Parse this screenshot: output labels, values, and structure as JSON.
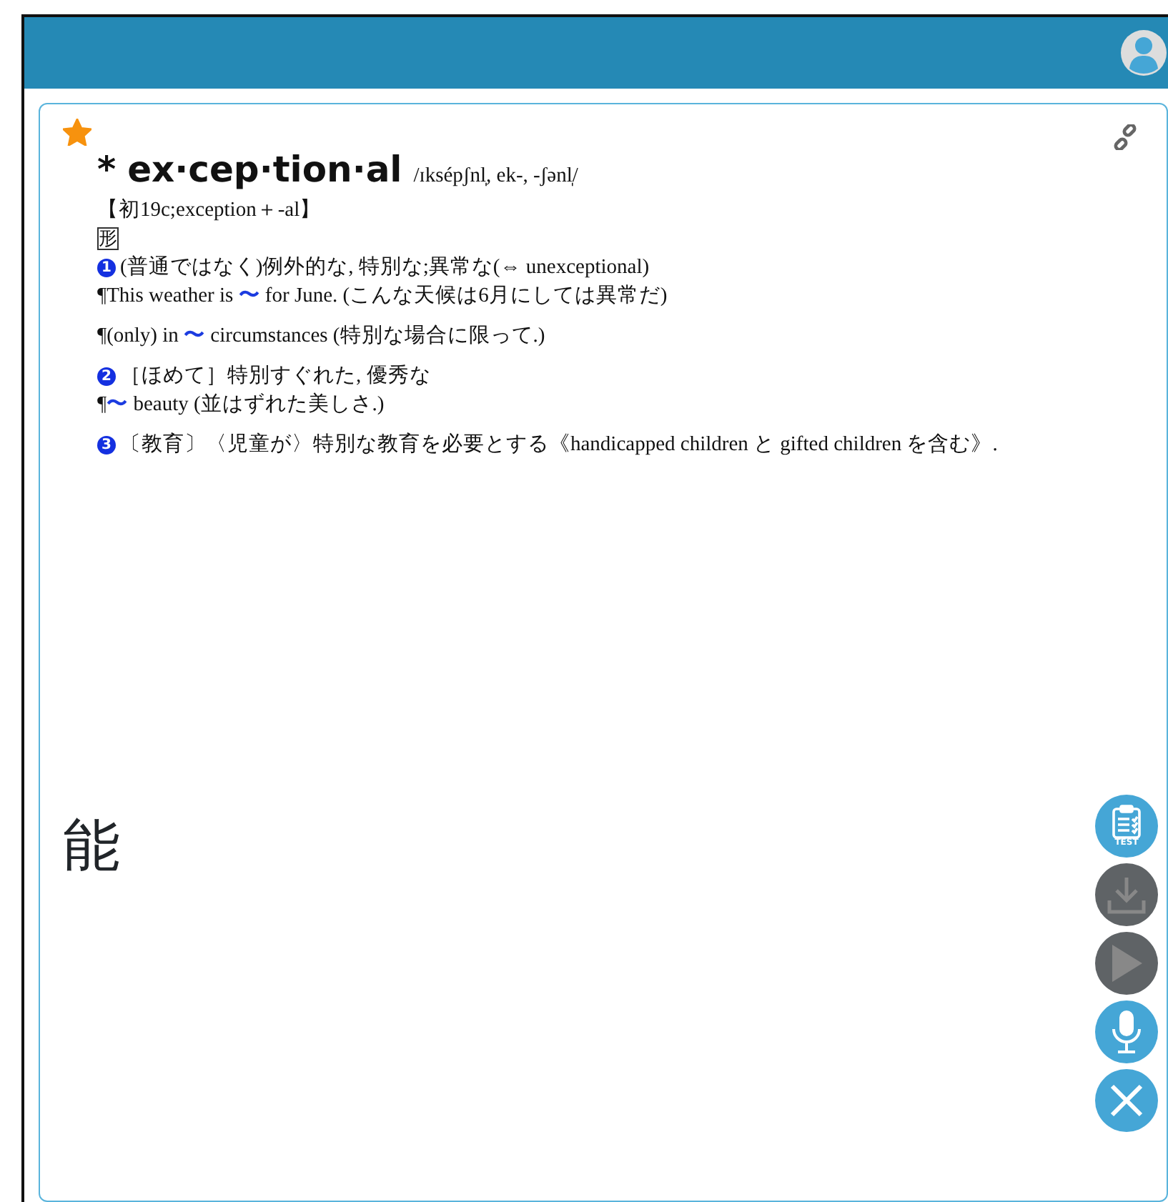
{
  "favorite": true,
  "entry": {
    "mark": "*",
    "headword": "ex·cep·tion·al",
    "pronunciation": "/ɪksépʃnl̩, ek-, -ʃənl̩/",
    "etymology": "【初19c;exception＋-al】",
    "part_of_speech": "形",
    "senses": [
      {
        "number": "1",
        "definition": "(普通ではなく)例外的な, 特別な;異常な(⇔ unexceptional)",
        "examples": [
          [
            {
              "kind": "text",
              "text": "¶This weather is "
            },
            {
              "kind": "swung-dash",
              "text": "〜"
            },
            {
              "kind": "text",
              "text": " for June. (こんな天候は6月にしては異常だ)"
            }
          ],
          [
            {
              "kind": "text",
              "text": "¶(only) in "
            },
            {
              "kind": "swung-dash",
              "text": "〜"
            },
            {
              "kind": "text",
              "text": " circumstances (特別な場合に限って.)"
            }
          ]
        ]
      },
      {
        "number": "2",
        "definition": "［ほめて］特別すぐれた, 優秀な",
        "examples": [
          [
            {
              "kind": "text",
              "text": "¶"
            },
            {
              "kind": "swung-dash",
              "text": "〜"
            },
            {
              "kind": "text",
              "text": " beauty (並はずれた美しさ.)"
            }
          ]
        ]
      },
      {
        "number": "3",
        "definition": "〔教育〕〈児童が〉特別な教育を必要とする《handicapped children と gifted children を含む》."
      }
    ]
  },
  "background_text": "能",
  "side_buttons": [
    {
      "kind": "test",
      "label": "TEST",
      "disabled": false
    },
    {
      "kind": "download",
      "disabled": true
    },
    {
      "kind": "play",
      "disabled": true
    },
    {
      "kind": "mic",
      "disabled": false
    },
    {
      "kind": "close",
      "disabled": false
    }
  ]
}
